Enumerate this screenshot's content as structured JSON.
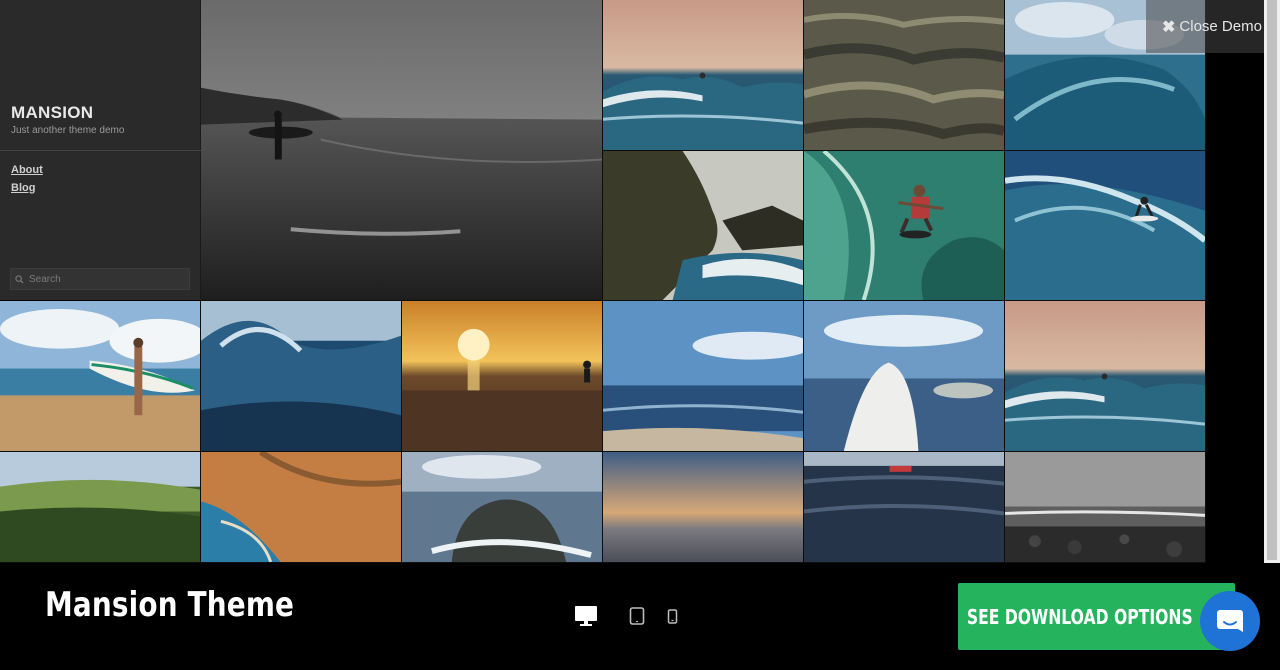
{
  "site": {
    "title": "MANSION",
    "tagline": "Just another theme demo",
    "nav": [
      {
        "label": "About"
      },
      {
        "label": "Blog"
      }
    ],
    "search_placeholder": "Search"
  },
  "close_demo": {
    "label": "Close Demo",
    "icon": "close-icon"
  },
  "gallery": {
    "photos": [
      "black-and-white surfer on beach",
      "surfer riding wave at dusk",
      "rolling ocean waves",
      "curling blue wave",
      "rocky coastline with surf",
      "surfer on green wave",
      "surfer on blue wave",
      "woman holding surfboard on beach",
      "wave close-up",
      "sunset over ocean with surfer",
      "blue sky over sea",
      "surfboard nose in water",
      "surfer riding wave at dusk",
      "green wave",
      "orange cliffs and cove",
      "rock in surf",
      "calm sea at dusk",
      "dark ocean with red boat",
      "pebble beach"
    ]
  },
  "bottom_bar": {
    "theme_name": "Mansion Theme",
    "devices": [
      "desktop-icon",
      "tablet-icon",
      "phone-icon"
    ],
    "download_label": "SEE DOWNLOAD OPTIONS",
    "chat_icon": "chat-icon"
  },
  "colors": {
    "download_button": "#25b35d",
    "chat_button": "#1f73d6",
    "sidebar_bg": "#2a2a2a"
  }
}
